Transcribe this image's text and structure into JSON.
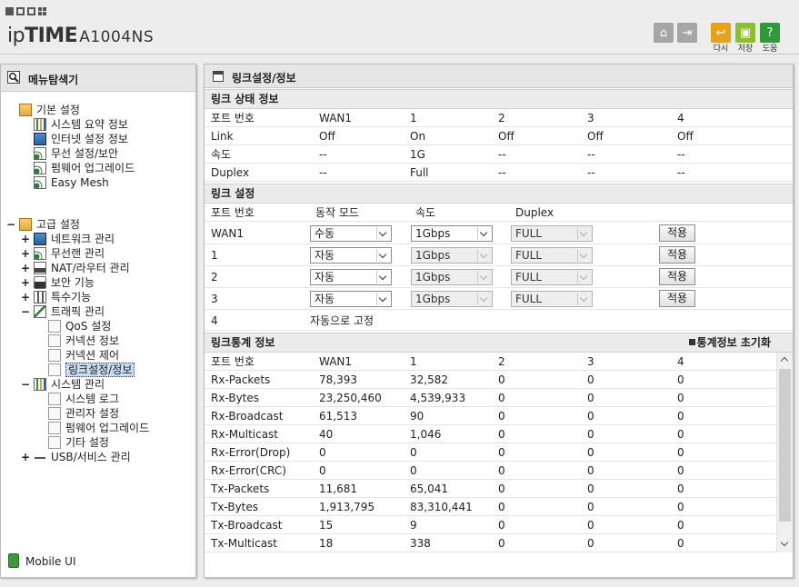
{
  "header": {
    "brand_ip": "ip",
    "brand_time": "TIME",
    "model": "A1004NS",
    "buttons": [
      {
        "icon": "home-icon",
        "label": "",
        "color": "#a6a6a6"
      },
      {
        "icon": "logout-icon",
        "label": "",
        "color": "#a6a6a6"
      },
      {
        "icon": "refresh-icon",
        "label": "다시",
        "color": "#e8a21a"
      },
      {
        "icon": "save-icon",
        "label": "저장",
        "color": "#8cbf2e"
      },
      {
        "icon": "help-icon",
        "label": "도움",
        "color": "#2f9a3c"
      }
    ]
  },
  "sidebar": {
    "title": "메뉴탐색기",
    "basic": {
      "label": "기본 설정",
      "items": [
        "시스템 요약 정보",
        "인터넷 설정 정보",
        "무선 설정/보안",
        "펌웨어 업그레이드",
        "Easy Mesh"
      ]
    },
    "advanced": {
      "label": "고급 설정",
      "toggle": "−",
      "items": [
        {
          "label": "네트워크 관리",
          "toggle": "+"
        },
        {
          "label": "무선랜 관리",
          "toggle": "+"
        },
        {
          "label": "NAT/라우터 관리",
          "toggle": "+"
        },
        {
          "label": "보안 기능",
          "toggle": "+"
        },
        {
          "label": "특수기능",
          "toggle": "+"
        },
        {
          "label": "트래픽 관리",
          "toggle": "−"
        }
      ],
      "traffic_children": [
        "QoS 설정",
        "커넥션 정보",
        "커넥션 제어",
        "링크설정/정보"
      ],
      "system": {
        "label": "시스템 관리",
        "toggle": "−"
      },
      "system_children": [
        "시스템 로그",
        "관리자 설정",
        "펌웨어 업그레이드",
        "기타 설정"
      ],
      "usb": {
        "label": "USB/서비스 관리",
        "toggle": "+"
      }
    },
    "mobile_ui": "Mobile UI"
  },
  "main": {
    "title": "링크설정/정보",
    "link_status": {
      "heading": "링크 상태 정보",
      "columns": [
        "포트 번호",
        "WAN1",
        "1",
        "2",
        "3",
        "4"
      ],
      "rows": [
        [
          "Link",
          "Off",
          "On",
          "Off",
          "Off",
          "Off"
        ],
        [
          "속도",
          "--",
          "1G",
          "--",
          "--",
          "--"
        ],
        [
          "Duplex",
          "--",
          "Full",
          "--",
          "--",
          "--"
        ]
      ]
    },
    "link_settings": {
      "heading": "링크 설정",
      "columns": [
        "포트 번호",
        "동작 모드",
        "속도",
        "Duplex"
      ],
      "rows": [
        {
          "port": "WAN1",
          "mode": "수동",
          "speed": "1Gbps",
          "duplex": "FULL",
          "speed_enabled": true
        },
        {
          "port": "1",
          "mode": "자동",
          "speed": "1Gbps",
          "duplex": "FULL",
          "speed_enabled": false
        },
        {
          "port": "2",
          "mode": "자동",
          "speed": "1Gbps",
          "duplex": "FULL",
          "speed_enabled": false
        },
        {
          "port": "3",
          "mode": "자동",
          "speed": "1Gbps",
          "duplex": "FULL",
          "speed_enabled": false
        }
      ],
      "apply_label": "적용",
      "fixed_port": "4",
      "fixed_text": "자동으로 고정"
    },
    "link_stats": {
      "heading": "링크통계 정보",
      "reset_label": "통계정보 초기화",
      "columns": [
        "포트 번호",
        "WAN1",
        "1",
        "2",
        "3",
        "4"
      ],
      "rows": [
        [
          "Rx-Packets",
          "78,393",
          "32,582",
          "0",
          "0",
          "0"
        ],
        [
          "Rx-Bytes",
          "23,250,460",
          "4,539,933",
          "0",
          "0",
          "0"
        ],
        [
          "Rx-Broadcast",
          "61,513",
          "90",
          "0",
          "0",
          "0"
        ],
        [
          "Rx-Multicast",
          "40",
          "1,046",
          "0",
          "0",
          "0"
        ],
        [
          "Rx-Error(Drop)",
          "0",
          "0",
          "0",
          "0",
          "0"
        ],
        [
          "Rx-Error(CRC)",
          "0",
          "0",
          "0",
          "0",
          "0"
        ],
        [
          "Tx-Packets",
          "11,681",
          "65,041",
          "0",
          "0",
          "0"
        ],
        [
          "Tx-Bytes",
          "1,913,795",
          "83,310,441",
          "0",
          "0",
          "0"
        ],
        [
          "Tx-Broadcast",
          "15",
          "9",
          "0",
          "0",
          "0"
        ],
        [
          "Tx-Multicast",
          "18",
          "338",
          "0",
          "0",
          "0"
        ]
      ]
    }
  }
}
